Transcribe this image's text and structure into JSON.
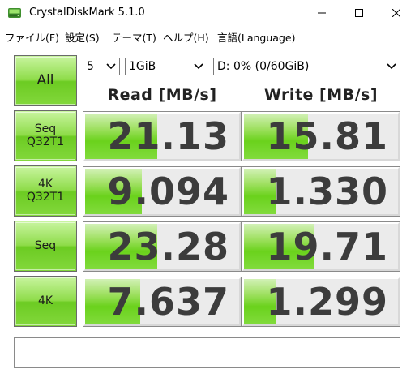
{
  "window": {
    "title": "CrystalDiskMark 5.1.0",
    "icon": "crystaldiskmark-app-icon"
  },
  "menu": [
    {
      "label": "ファイル(F)"
    },
    {
      "label": "設定(S)"
    },
    {
      "label": "テーマ(T)"
    },
    {
      "label": "ヘルプ(H)"
    },
    {
      "label": "言語(Language)"
    }
  ],
  "controls": {
    "all_label": "All",
    "count_value": "5",
    "size_value": "1GiB",
    "drive_value": "D: 0% (0/60GiB)"
  },
  "headers": {
    "read": "Read [MB/s]",
    "write": "Write [MB/s]"
  },
  "tests": [
    {
      "label_line1": "Seq",
      "label_line2": "Q32T1",
      "read": "21.13",
      "write": "15.81",
      "read_fill": 0.47,
      "write_fill": 0.42
    },
    {
      "label_line1": "4K",
      "label_line2": "Q32T1",
      "read": "9.094",
      "write": "1.330",
      "read_fill": 0.37,
      "write_fill": 0.21
    },
    {
      "label_line1": "Seq",
      "label_line2": "",
      "read": "23.28",
      "write": "19.71",
      "read_fill": 0.47,
      "write_fill": 0.46
    },
    {
      "label_line1": "4K",
      "label_line2": "",
      "read": "7.637",
      "write": "1.299",
      "read_fill": 0.36,
      "write_fill": 0.21
    }
  ],
  "comment_value": ""
}
